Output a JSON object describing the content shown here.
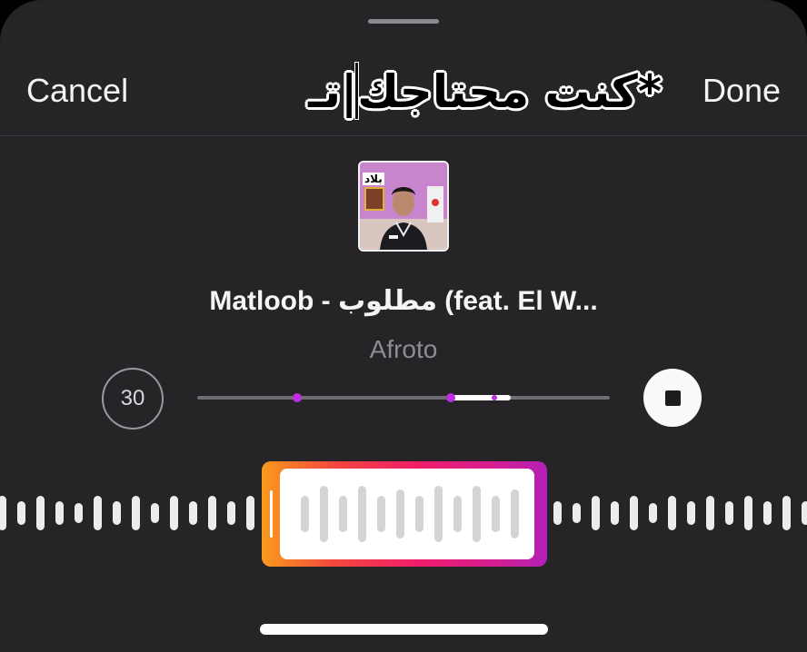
{
  "header": {
    "cancel_label": "Cancel",
    "done_label": "Done",
    "text_input_value": "*كنت محتاجك|تـ"
  },
  "track": {
    "title": "Matloob - مطلوب (feat. El W...",
    "artist": "Afroto",
    "cover_badge": "بلاد"
  },
  "controls": {
    "duration_label": "30",
    "stop_icon": "stop-icon"
  },
  "colors": {
    "sheet_background": "#262427",
    "accent_gradient": [
      "#f99a1d",
      "#f5483d",
      "#ef1d6a",
      "#d71e8f",
      "#b321b7"
    ],
    "marker": "#c12de0"
  }
}
